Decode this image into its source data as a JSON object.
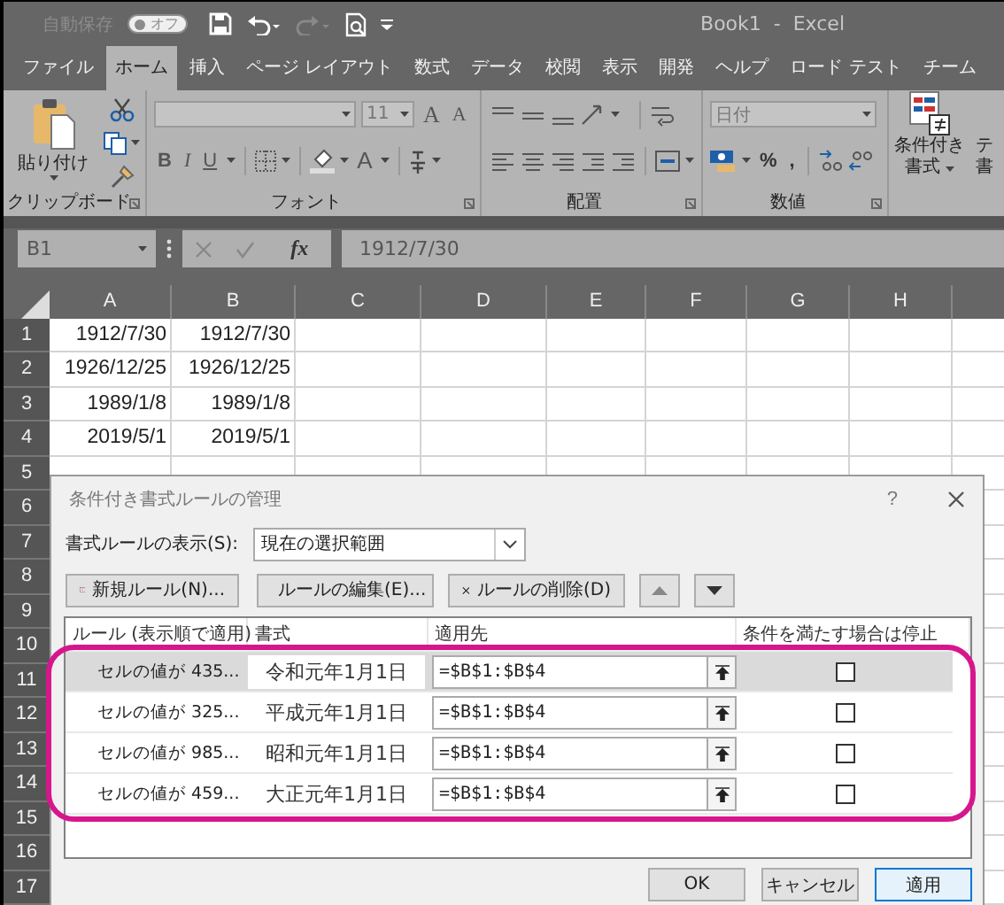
{
  "title_bar": {
    "autosave_label": "自動保存",
    "autosave_toggle": {
      "label": "オフ",
      "on": false
    },
    "title": "Book1  -  Excel"
  },
  "tabs": [
    {
      "label": "ファイル",
      "selected": false
    },
    {
      "label": "ホーム",
      "selected": true
    },
    {
      "label": "挿入",
      "selected": false
    },
    {
      "label": "ページ レイアウト",
      "selected": false
    },
    {
      "label": "数式",
      "selected": false
    },
    {
      "label": "データ",
      "selected": false
    },
    {
      "label": "校閲",
      "selected": false
    },
    {
      "label": "表示",
      "selected": false
    },
    {
      "label": "開発",
      "selected": false
    },
    {
      "label": "ヘルプ",
      "selected": false
    },
    {
      "label": "ロード テスト",
      "selected": false
    },
    {
      "label": "チーム",
      "selected": false
    }
  ],
  "ribbon": {
    "clipboard": {
      "paste": "貼り付け",
      "label": "クリップボード"
    },
    "font": {
      "size": "11",
      "grow": "A",
      "shrink": "A",
      "bold": "B",
      "italic": "I",
      "underline": "U",
      "font_color": "A",
      "label": "フォント"
    },
    "alignment": {
      "label": "配置"
    },
    "number": {
      "format": "日付",
      "percent": "%",
      "comma": ",",
      "label": "数値"
    },
    "styles": {
      "conditional": [
        "条件付き",
        "書式"
      ],
      "cut_off": [
        "テ",
        "書"
      ]
    }
  },
  "formula_bar": {
    "name_box": "B1",
    "fx": "fx",
    "formula": "1912/7/30"
  },
  "sheet": {
    "columns": [
      "A",
      "B",
      "C",
      "D",
      "E",
      "F",
      "G",
      "H"
    ],
    "rows": [
      {
        "number": "1",
        "cells": [
          "1912/7/30",
          "1912/7/30"
        ]
      },
      {
        "number": "2",
        "cells": [
          "1926/12/25",
          "1926/12/25"
        ]
      },
      {
        "number": "3",
        "cells": [
          "1989/1/8",
          "1989/1/8"
        ]
      },
      {
        "number": "4",
        "cells": [
          "2019/5/1",
          "2019/5/1"
        ]
      },
      {
        "number": "5"
      },
      {
        "number": "6"
      },
      {
        "number": "7"
      },
      {
        "number": "8"
      },
      {
        "number": "9"
      },
      {
        "number": "10"
      },
      {
        "number": "11"
      },
      {
        "number": "12"
      },
      {
        "number": "13"
      },
      {
        "number": "14"
      },
      {
        "number": "15"
      },
      {
        "number": "16"
      },
      {
        "number": "17"
      }
    ]
  },
  "dialog": {
    "title": "条件付き書式ルールの管理",
    "help": "?",
    "show_label": "書式ルールの表示(S):",
    "scope": "現在の選択範囲",
    "buttons": [
      "新規ルール(N)...",
      "ルールの編集(E)...",
      "ルールの削除(D)"
    ],
    "columns": [
      "ルール (表示順で適用)",
      "書式",
      "適用先",
      "条件を満たす場合は停止"
    ],
    "rules": [
      {
        "condition": "セルの値が 435...",
        "preview": "令和元年1月1日",
        "applies_to": "=$B$1:$B$4",
        "stop_if_true": false,
        "selected": true
      },
      {
        "condition": "セルの値が 325...",
        "preview": "平成元年1月1日",
        "applies_to": "=$B$1:$B$4",
        "stop_if_true": false,
        "selected": false
      },
      {
        "condition": "セルの値が 985...",
        "preview": "昭和元年1月1日",
        "applies_to": "=$B$1:$B$4",
        "stop_if_true": false,
        "selected": false
      },
      {
        "condition": "セルの値が 459...",
        "preview": "大正元年1月1日",
        "applies_to": "=$B$1:$B$4",
        "stop_if_true": false,
        "selected": false
      }
    ],
    "footer_buttons": [
      {
        "label": "OK",
        "focused": false
      },
      {
        "label": "キャンセル",
        "focused": false
      },
      {
        "label": "適用",
        "focused": true
      }
    ]
  }
}
